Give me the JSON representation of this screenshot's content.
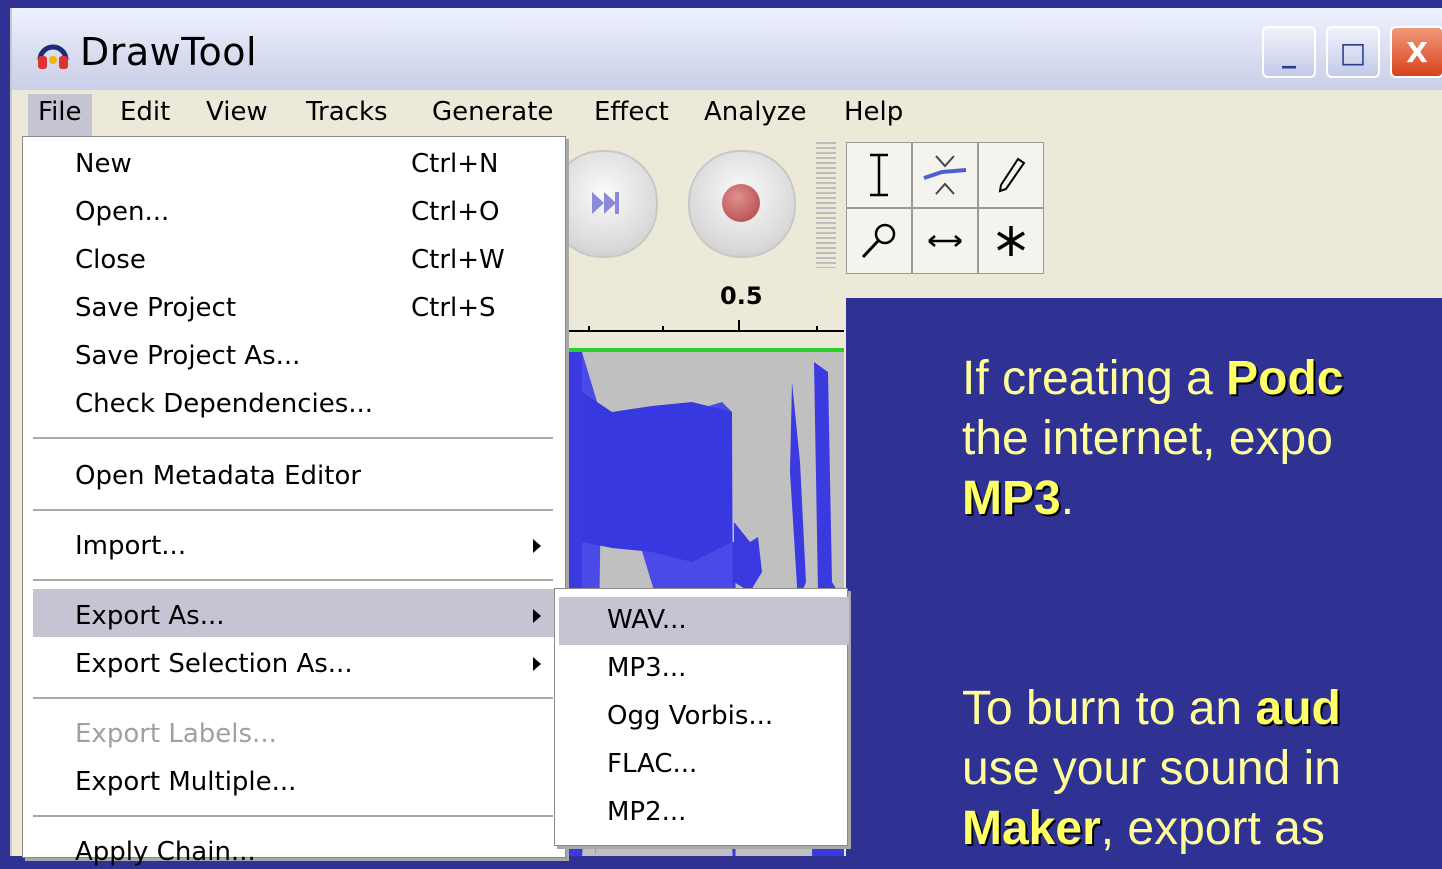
{
  "window": {
    "title": "DrawTool",
    "icon": "headphones-app-icon"
  },
  "window_controls": {
    "minimize": "_",
    "maximize": "□",
    "close": "X"
  },
  "menubar": [
    "File",
    "Edit",
    "View",
    "Tracks",
    "Generate",
    "Effect",
    "Analyze",
    "Help"
  ],
  "ruler": {
    "tick_label": "0.5"
  },
  "file_menu": {
    "items": [
      {
        "label": "New",
        "shortcut": "Ctrl+N"
      },
      {
        "label": "Open...",
        "shortcut": "Ctrl+O"
      },
      {
        "label": "Close",
        "shortcut": "Ctrl+W"
      },
      {
        "label": "Save Project",
        "shortcut": "Ctrl+S"
      },
      {
        "label": "Save Project As...",
        "shortcut": ""
      },
      {
        "label": "Check Dependencies...",
        "shortcut": ""
      },
      {
        "label": "Open Metadata Editor",
        "shortcut": ""
      },
      {
        "label": "Import...",
        "shortcut": ""
      },
      {
        "label": "Export As...",
        "shortcut": ""
      },
      {
        "label": "Export Selection As...",
        "shortcut": ""
      },
      {
        "label": "Export Labels...",
        "shortcut": ""
      },
      {
        "label": "Export Multiple...",
        "shortcut": ""
      },
      {
        "label": "Apply Chain...",
        "shortcut": ""
      }
    ]
  },
  "export_submenu": [
    "WAV...",
    "MP3...",
    "Ogg Vorbis...",
    "FLAC...",
    "MP2..."
  ],
  "tools": [
    "selection-tool",
    "envelope-tool",
    "draw-tool",
    "zoom-tool",
    "timeshift-tool",
    "multi-tool"
  ],
  "slide": {
    "p1_a": "If creating a ",
    "p1_b": "Podc",
    "p1_c": "the internet, expo",
    "p1_d": "MP3",
    "p1_e": ".",
    "p2_a": "To burn to an ",
    "p2_b": "aud",
    "p2_c": "use your sound in",
    "p2_d": "Maker",
    "p2_e": ", export as"
  },
  "colors": {
    "background": "#2f3193",
    "slide_text": "#ffff99",
    "menu_highlight": "#c4c4d2",
    "waveform": "#3a3ae0"
  }
}
